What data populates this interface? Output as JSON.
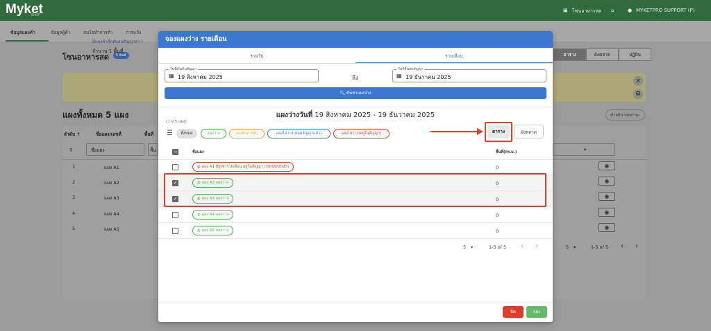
{
  "topbar": {
    "logo": "Myket",
    "logo_sub": "SHOP",
    "store": "โซนอาหารสด",
    "user": "MYKETPRO SUPPORT (P)"
  },
  "nav": {
    "tabs": [
      "ข้อมูลแผงค้า",
      "ข้อมูลผู้ค้า",
      "สมโอทำการค้า",
      "การแจ้ง"
    ]
  },
  "background": {
    "title": "โซนอาหารสด",
    "badge": "5 ดินส์",
    "tabs": [
      "ตาราง",
      "ผังตลาด",
      "ปฏิทิน"
    ],
    "notice_line1": "มีแผงค้าที่กลับลบสัญญาค่า !",
    "notice_line2": "จำนวน 1 พื้นที่",
    "heading": "แผงทั้งหมด 5 แผง",
    "help": "คำอธิบายสถานะ",
    "col_sort": "ลำดับ ↑",
    "col_name": "ชื่อแผง/เลขที่",
    "col_area": "พื้นที่",
    "filter_placeholder": "ชื่อแผง",
    "filter_area": "พื้น",
    "rows": [
      {
        "no": "1",
        "name": "แผง A1"
      },
      {
        "no": "2",
        "name": "แผง A2"
      },
      {
        "no": "3",
        "name": "แผง A3"
      },
      {
        "no": "4",
        "name": "แผง A4"
      },
      {
        "no": "5",
        "name": "แผง A5"
      }
    ],
    "page_size": "5",
    "page_range": "1-5 of 5"
  },
  "modal": {
    "title": "จองแผงว่าง รายเดือน",
    "tabs": [
      "รายวัน",
      "รายเดือน"
    ],
    "start_label": "วันที่เริ่มต้นสัญญา",
    "start_value": "19 สิงหาคม 2025",
    "to_label": "ถึง",
    "end_label": "วันที่สิ้นสุดสัญญา",
    "end_value": "19 ธันวาคม 2025",
    "search_button": "ค้นหาแผงว่าง",
    "heading_bold": "แผงว่างวันที่",
    "heading_range": "19 สิงหาคม 2025 - 19 ธันวาคม 2025",
    "free_count": "(ว่าง 5 แผง)",
    "chips": [
      {
        "label": "ทั้งหมด",
        "color": "#666666"
      },
      {
        "label": "แผงว่าง",
        "color": "#4caf50"
      },
      {
        "label": "แผงพักการค้า",
        "color": "#f0a030"
      },
      {
        "label": "แผงไม่ว่าง(หมดสัญญาแล้ว)",
        "color": "#3b78d0"
      },
      {
        "label": "แผงไม่ว่าง(อยู่ในสัญญา)",
        "color": "#d9412b"
      }
    ],
    "view_table": "ตาราง",
    "view_map": "ผังตลาด",
    "col_name": "ชื่อแผง",
    "col_area": "พื้นที่(ตร.ม.)",
    "rows": [
      {
        "label": "แผง A1 มีผู้เช่ารายเดือน อยู่ในสัญญา (19/09/2025)",
        "status": "occupied",
        "checked": false,
        "area": "0"
      },
      {
        "label": "แผง A2 แผงว่าง",
        "status": "free",
        "checked": true,
        "area": "0"
      },
      {
        "label": "แผง A3 แผงว่าง",
        "status": "free",
        "checked": true,
        "area": "0"
      },
      {
        "label": "แผง A4 แผงว่าง",
        "status": "free",
        "checked": false,
        "area": "0"
      },
      {
        "label": "แผง A5 แผงว่าง",
        "status": "free",
        "checked": false,
        "area": "0"
      }
    ],
    "page_size": "5",
    "page_range": "1-5 of 5",
    "close_button": "ปิด",
    "book_button": "จอง",
    "colors": {
      "primary": "#3b78d0",
      "free": "#4caf50",
      "occupied": "#d9412b",
      "close": "#d9412b",
      "book": "#66bb6a",
      "annotation": "#d9412b"
    }
  }
}
